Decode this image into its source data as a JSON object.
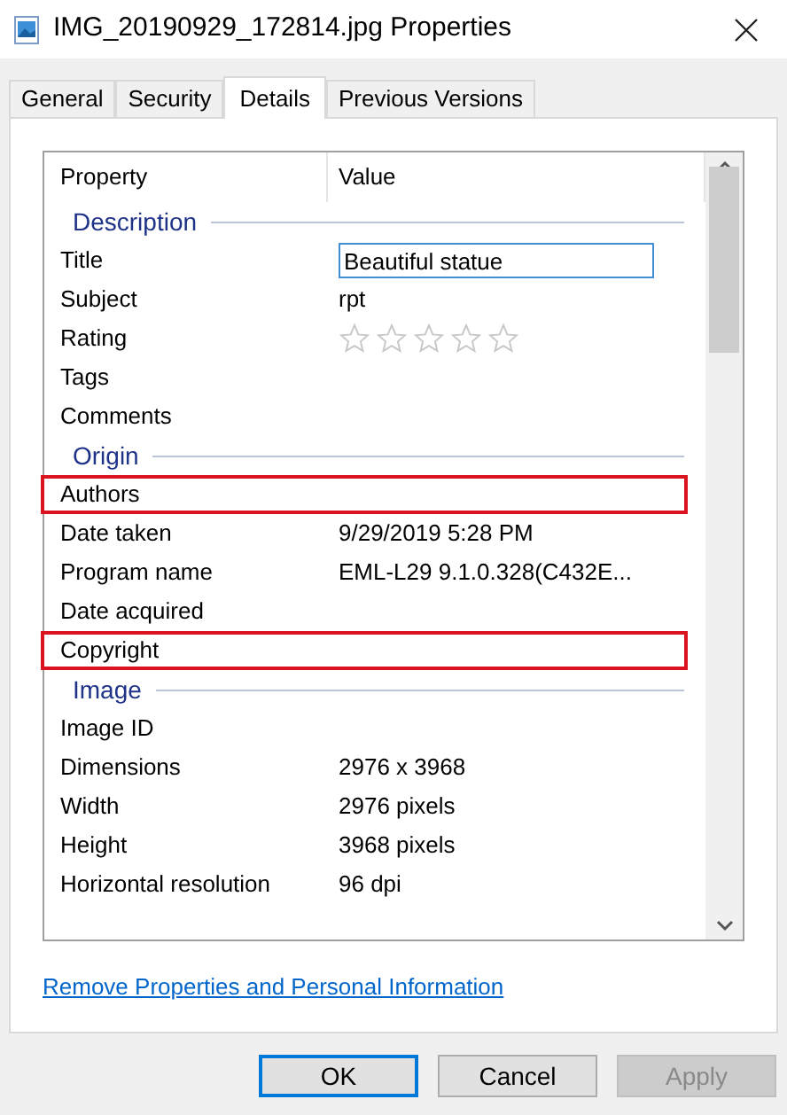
{
  "window": {
    "title": "IMG_20190929_172814.jpg Properties"
  },
  "tabs": [
    {
      "label": "General",
      "selected": false
    },
    {
      "label": "Security",
      "selected": false
    },
    {
      "label": "Details",
      "selected": true
    },
    {
      "label": "Previous Versions",
      "selected": false
    }
  ],
  "table": {
    "columns": [
      "Property",
      "Value"
    ],
    "rows": [
      {
        "kind": "group",
        "label": "Description"
      },
      {
        "kind": "field",
        "property": "Title",
        "value": "Beautiful statue",
        "highlighted": false
      },
      {
        "kind": "text",
        "property": "Subject",
        "value": "rpt",
        "highlighted": false
      },
      {
        "kind": "stars",
        "property": "Rating",
        "stars": 0,
        "highlighted": false
      },
      {
        "kind": "text",
        "property": "Tags",
        "highlighted": false
      },
      {
        "kind": "text",
        "property": "Comments",
        "highlighted": false
      },
      {
        "kind": "group",
        "label": "Origin"
      },
      {
        "kind": "text",
        "property": "Authors",
        "highlighted": true
      },
      {
        "kind": "text",
        "property": "Date taken",
        "value": "9/29/2019 5:28 PM",
        "highlighted": false
      },
      {
        "kind": "text",
        "property": "Program name",
        "value": "EML-L29 9.1.0.328(C432E...",
        "highlighted": false
      },
      {
        "kind": "text",
        "property": "Date acquired",
        "highlighted": false
      },
      {
        "kind": "text",
        "property": "Copyright",
        "highlighted": true
      },
      {
        "kind": "group",
        "label": "Image"
      },
      {
        "kind": "text",
        "property": "Image ID",
        "highlighted": false
      },
      {
        "kind": "text",
        "property": "Dimensions",
        "value": "2976 x 3968",
        "highlighted": false
      },
      {
        "kind": "text",
        "property": "Width",
        "value": "2976 pixels",
        "highlighted": false
      },
      {
        "kind": "text",
        "property": "Height",
        "value": "3968 pixels",
        "highlighted": false
      },
      {
        "kind": "text",
        "property": "Horizontal resolution",
        "value": "96 dpi",
        "highlighted": false
      }
    ]
  },
  "link": "Remove Properties and Personal Information",
  "buttons": [
    {
      "label": "OK",
      "default": true,
      "disabled": false
    },
    {
      "label": "Cancel",
      "default": false,
      "disabled": false
    },
    {
      "label": "Apply",
      "default": false,
      "disabled": true
    }
  ]
}
